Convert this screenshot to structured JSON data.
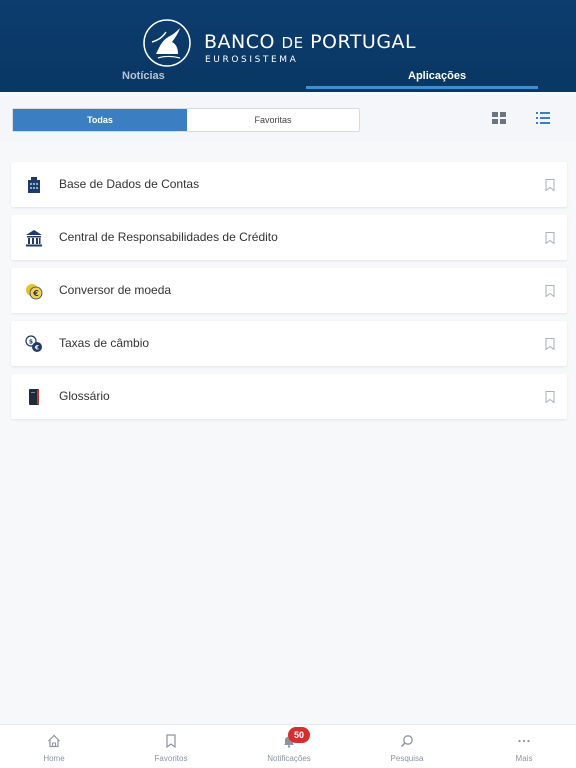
{
  "header": {
    "brand_name": "BANCO",
    "brand_connector": "DE",
    "brand_country": "PORTUGAL",
    "brand_subtitle": "EUROSISTEMA",
    "tabs": [
      {
        "label": "Notícias",
        "active": false
      },
      {
        "label": "Aplicações",
        "active": true
      }
    ]
  },
  "filter": {
    "segments": [
      {
        "label": "Todas",
        "active": true
      },
      {
        "label": "Favoritas",
        "active": false
      }
    ],
    "view_modes": [
      {
        "icon": "grid-icon",
        "active": false
      },
      {
        "icon": "list-icon",
        "active": true
      }
    ]
  },
  "apps": [
    {
      "label": "Base de Dados de Contas",
      "icon": "building-icon"
    },
    {
      "label": "Central de Responsabilidades de Crédito",
      "icon": "bank-icon"
    },
    {
      "label": "Conversor de moeda",
      "icon": "coin-icon"
    },
    {
      "label": "Taxas de câmbio",
      "icon": "exchange-icon"
    },
    {
      "label": "Glossário",
      "icon": "book-icon"
    }
  ],
  "bottom_nav": [
    {
      "label": "Home",
      "icon": "home-icon"
    },
    {
      "label": "Favoritos",
      "icon": "bookmark-icon"
    },
    {
      "label": "Notificações",
      "icon": "bell-icon",
      "badge": "50"
    },
    {
      "label": "Pesquisa",
      "icon": "search-icon"
    },
    {
      "label": "Mais",
      "icon": "more-icon"
    }
  ],
  "colors": {
    "header_bg": "#0c3d6f",
    "accent": "#3b7fc2",
    "tab_indicator": "#3b8fd6",
    "badge": "#d32f2f"
  }
}
